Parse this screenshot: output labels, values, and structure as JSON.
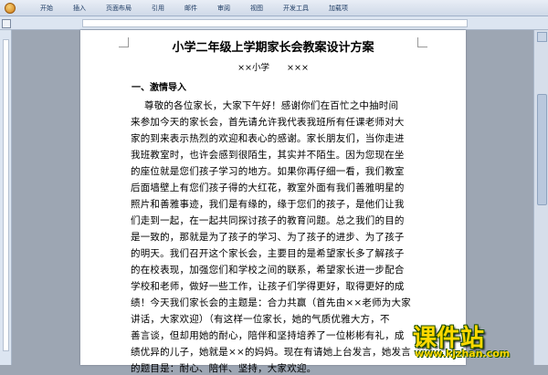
{
  "ribbon": {
    "tabs": [
      "开始",
      "插入",
      "页面布局",
      "引用",
      "邮件",
      "审阅",
      "视图",
      "开发工具",
      "加载项"
    ]
  },
  "document": {
    "title": "小学二年级上学期家长会教案设计方案",
    "subtitle": {
      "school": "××小学",
      "teacher": "×××"
    },
    "heading": "一、激情导入",
    "lines": [
      "尊敬的各位家长，大家下午好！感谢你们在百忙之中抽时间",
      "来参加今天的家长会，首先请允许我代表我班所有任课老师对大",
      "家的到来表示热烈的欢迎和表心的感谢。家长朋友们，当你走进",
      "我班教室时，也许会感到很陌生，其实并不陌生。因为您现在坐",
      "的座位就是您们孩子学习的地方。如果你再仔细一看，我们教室",
      "后面墙壁上有您们孩子得的大红花，教室外面有我们善雅明星的",
      "照片和善雅事迹，我们是有缘的，缘于您们的孩子，是他们让我",
      "们走到一起，在一起共同探讨孩子的教育问题。总之我们的目的",
      "是一致的，那就是为了孩子的学习、为了孩子的进步、为了孩子",
      "的明天。我们召开这个家长会，主要目的是希望家长多了解孩子",
      "的在校表现，加强您们和学校之间的联系，希望家长进一步配合",
      "学校和老师，做好一些工作，让孩子们学得更好，取得更好的成",
      "绩！今天我们家长会的主题是：合力共赢（首先由××老师为大家",
      "讲话，大家欢迎）（有这样一位家长，她的气质优雅大方，不",
      "善言谈，但却用她的耐心，陪伴和坚持培养了一位彬彬有礼，成",
      "绩优异的儿子，她就是××的妈妈。现在有请她上台发言，她发言",
      "的题目是：耐心、陪伴、坚持，大家欢迎。"
    ]
  },
  "watermark": {
    "text": "课件站",
    "url": "www.kjzhan.com"
  }
}
